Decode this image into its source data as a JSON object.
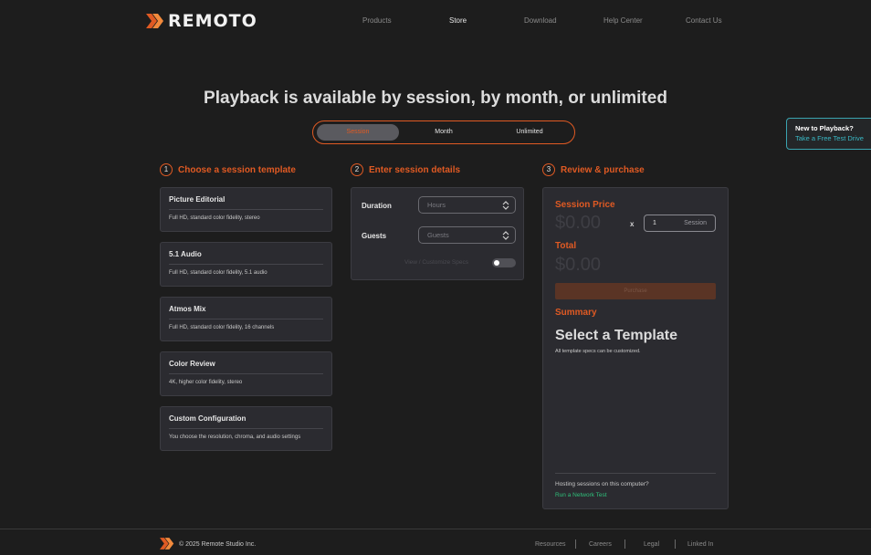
{
  "brand": {
    "name": "REMOTO",
    "accent": "#e05a23",
    "link_color": "#2fbf7a",
    "teal": "#39b8c4"
  },
  "nav": {
    "items": [
      {
        "label": "Products"
      },
      {
        "label": "Store"
      },
      {
        "label": "Download"
      },
      {
        "label": "Help Center"
      },
      {
        "label": "Contact Us"
      }
    ],
    "active": "Store"
  },
  "headline": "Playback is available by session, by month, or unlimited",
  "plan_toggle": {
    "options": [
      "Session",
      "Month",
      "Unlimited"
    ],
    "selected": "Session"
  },
  "promo": {
    "title": "New to Playback?",
    "link": "Take a Free Test Drive"
  },
  "steps": [
    {
      "num": "1",
      "title": "Choose a session template"
    },
    {
      "num": "2",
      "title": "Enter session details"
    },
    {
      "num": "3",
      "title": "Review & purchase"
    }
  ],
  "templates": [
    {
      "title": "Picture Editorial",
      "desc": "Full HD, standard color fidelity, stereo"
    },
    {
      "title": "5.1 Audio",
      "desc": "Full HD, standard color fidelity, 5.1 audio"
    },
    {
      "title": "Atmos Mix",
      "desc": "Full HD, standard color fidelity, 16 channels"
    },
    {
      "title": "Color Review",
      "desc": "4K, higher color fidelity, stereo"
    },
    {
      "title": "Custom Configuration",
      "desc": "You choose the resolution, chroma, and audio settings"
    }
  ],
  "details": {
    "duration_label": "Duration",
    "duration_placeholder": "Hours",
    "guests_label": "Guests",
    "guests_placeholder": "Guests",
    "view_customize": "View / Customize Specs",
    "toggle_on": false
  },
  "review": {
    "session_price_label": "Session Price",
    "session_price": "$0.00",
    "times": "x",
    "qty_value": "1",
    "qty_unit": "Session",
    "total_label": "Total",
    "total": "$0.00",
    "purchase_label": "Purchase",
    "summary_label": "Summary",
    "summary_title": "Select a Template",
    "summary_note": "All template specs can be customized.",
    "hosting_text": "Hosting sessions on this computer?",
    "network_link": "Run a Network Test"
  },
  "footer": {
    "copyright": "© 2025 Remote Studio Inc.",
    "links": [
      "Resources",
      "Careers",
      "Legal",
      "Linked In"
    ]
  }
}
